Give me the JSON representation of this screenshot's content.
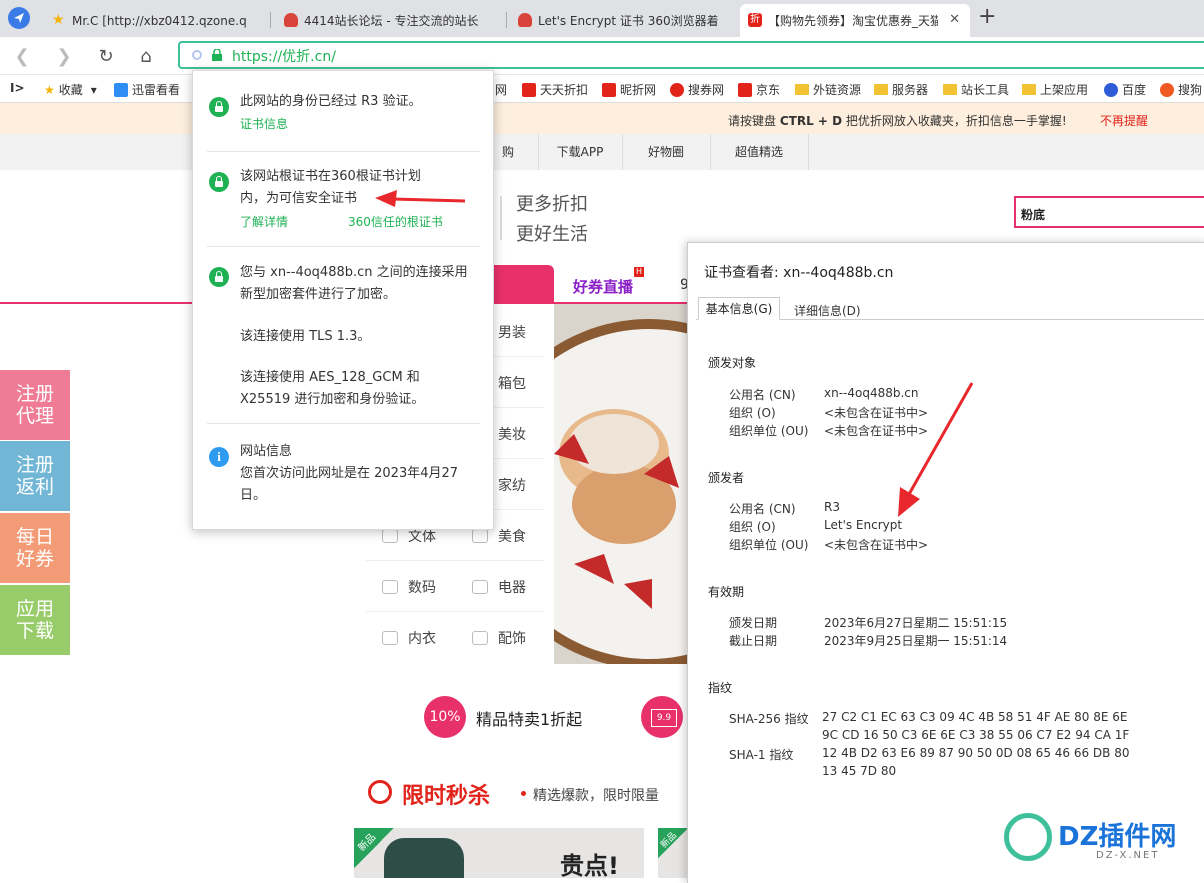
{
  "tabs": [
    {
      "title": "Mr.C [http://xbz0412.qzone.q",
      "favicon": "star-icon"
    },
    {
      "title": "4414站长论坛 - 专注交流的站长",
      "favicon": "mushroom-icon"
    },
    {
      "title": "Let's Encrypt 证书 360浏览器着",
      "favicon": "mushroom-icon"
    },
    {
      "title": "【购物先领券】淘宝优惠券_天猫",
      "favicon": "zhe-logo-icon"
    }
  ],
  "new_tab": "+",
  "address": {
    "url": "https://优折.cn/"
  },
  "bookmarks": {
    "show_sidebar": "I>",
    "favorites": "收藏",
    "items": [
      "迅雷看看",
      "网",
      "天天折扣",
      "昵折网",
      "搜券网",
      "京东",
      "外链资源",
      "服务器",
      "站长工具",
      "上架应用",
      "百度",
      "搜狗"
    ]
  },
  "notice": {
    "text_pre": "请按键盘",
    "keys": "CTRL + D",
    "text_post": "把优折网放入收藏夹，折扣信息一手掌握!",
    "dismiss": "不再提醒"
  },
  "cat_nav": [
    "购",
    "下载APP",
    "好物圈",
    "超值精选"
  ],
  "slogan": {
    "line1": "更多折扣",
    "line2": "更好生活"
  },
  "search": {
    "value": "粉底"
  },
  "tabs_row": {
    "label1": "好券直播",
    "badge": "H",
    "label2": "9"
  },
  "side_buttons": [
    {
      "text": "注册代理",
      "color": "#ef7b94"
    },
    {
      "text": "注册返利",
      "color": "#72b6d6"
    },
    {
      "text": "每日好券",
      "color": "#f39a76"
    },
    {
      "text": "应用下载",
      "color": "#98cc6a"
    }
  ],
  "categories": [
    {
      "left": "",
      "right": "男装"
    },
    {
      "left": "",
      "right": "箱包"
    },
    {
      "left": "",
      "right": "美妆"
    },
    {
      "left": "",
      "right": "家纺"
    },
    {
      "left": "文体",
      "right": "美食"
    },
    {
      "left": "数码",
      "right": "电器"
    },
    {
      "left": "内衣",
      "right": "配饰"
    }
  ],
  "promo": {
    "badge": "10%",
    "text": "精品特卖1折起",
    "badge2": "9.9"
  },
  "flash": {
    "title": "限时秒杀",
    "subtitle": "精选爆款，限时限量"
  },
  "product": {
    "tag": "新品",
    "text": "贵点!",
    "tag2": "新品"
  },
  "popup": {
    "s1": {
      "title": "此网站的身份已经过 R3 验证。",
      "link": "证书信息"
    },
    "s2": {
      "line1": "该网站根证书在360根证书计划",
      "line2": "内，为可信安全证书",
      "link1": "了解详情",
      "link2": "360信任的根证书"
    },
    "s3": {
      "line1": "您与 xn--4oq488b.cn 之间的连接采用",
      "line2": "新型加密套件进行了加密。",
      "line3": "该连接使用 TLS 1.3。",
      "line4": "该连接使用 AES_128_GCM 和",
      "line5": "X25519 进行加密和身份验证。"
    },
    "s4": {
      "title": "网站信息",
      "line1": "您首次访问此网址是在 2023年4月27",
      "line2": "日。"
    }
  },
  "cert": {
    "title": "证书查看者: xn--4oq488b.cn",
    "tab_basic": "基本信息(G)",
    "tab_detail": "详细信息(D)",
    "issued_to": {
      "heading": "颁发对象",
      "cn_label": "公用名 (CN)",
      "cn": "xn--4oq488b.cn",
      "o_label": "组织 (O)",
      "o": "<未包含在证书中>",
      "ou_label": "组织单位 (OU)",
      "ou": "<未包含在证书中>"
    },
    "issuer": {
      "heading": "颁发者",
      "cn_label": "公用名 (CN)",
      "cn": "R3",
      "o_label": "组织 (O)",
      "o": "Let's Encrypt",
      "ou_label": "组织单位 (OU)",
      "ou": "<未包含在证书中>"
    },
    "validity": {
      "heading": "有效期",
      "issued_label": "颁发日期",
      "issued": "2023年6月27日星期二 15:51:15",
      "expires_label": "截止日期",
      "expires": "2023年9月25日星期一 15:51:14"
    },
    "fingerprint": {
      "heading": "指纹",
      "sha256_label": "SHA-256 指纹",
      "sha256_1": "27 C2 C1 EC 63 C3 09 4C 4B 58 51 4F AE 80 8E 6E",
      "sha256_2": "9C CD 16 50 C3 6E 6E C3 38 55 06 C7 E2 94 CA 1F",
      "sha1_label": "SHA-1 指纹",
      "sha1_1": "12 4B D2 63 E6 89 87 90 50 0D 08 65 46 66 DB 80",
      "sha1_2": "13 45 7D 80"
    }
  },
  "watermark": {
    "brand": "DZ插件网",
    "url": "DZ-X.NET"
  }
}
